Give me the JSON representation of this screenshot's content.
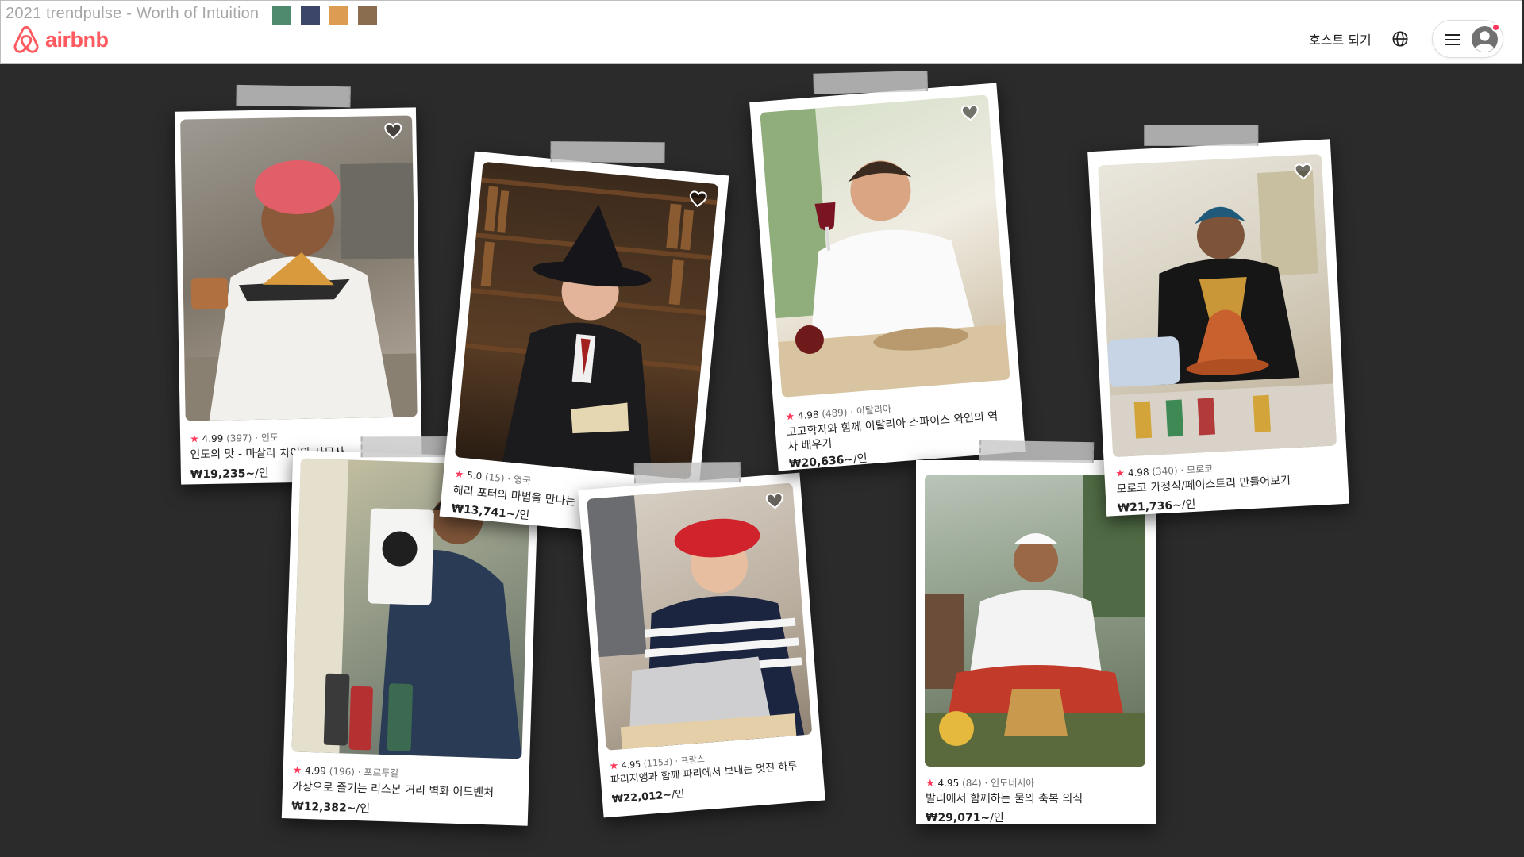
{
  "page_caption": "2021 trendpulse - Worth of Intuition",
  "palette": [
    "#4f8a6f",
    "#3c4668",
    "#dc9d52",
    "#8a6c4e"
  ],
  "brand": {
    "name": "airbnb",
    "color": "#FF5A5F"
  },
  "nav": {
    "host_link": "호스트 되기",
    "globe_icon": "globe-icon",
    "menu_icon": "menu-icon",
    "avatar_icon": "user-avatar-icon"
  },
  "experiences": [
    {
      "rating": "4.99",
      "reviews": "(397)",
      "location": "· 인도",
      "title": "인도의 맛 - 마살라 차이와 사모사",
      "price": "₩19,235~",
      "unit": "/인"
    },
    {
      "rating": "5.0",
      "reviews": "(15)",
      "location": "· 영국",
      "title": "해리 포터의 마법을 만나는 런던 온라인 투어",
      "price": "₩13,741~",
      "unit": "/인"
    },
    {
      "rating": "4.98",
      "reviews": "(489)",
      "location": "· 이탈리아",
      "title": "고고학자와 함께 이탈리아 스파이스 와인의 역사 배우기",
      "price": "₩20,636~",
      "unit": "/인"
    },
    {
      "rating": "4.98",
      "reviews": "(340)",
      "location": "· 모로코",
      "title": "모로코 가정식/페이스트리 만들어보기",
      "price": "₩21,736~",
      "unit": "/인"
    },
    {
      "rating": "4.99",
      "reviews": "(196)",
      "location": "· 포르투갈",
      "title": "가상으로 즐기는 리스본 거리 벽화 어드벤처",
      "price": "₩12,382~",
      "unit": "/인"
    },
    {
      "rating": "4.95",
      "reviews": "(1153)",
      "location": "· 프랑스",
      "title": "파리지앵과 함께 파리에서 보내는 멋진 하루",
      "price": "₩22,012~",
      "unit": "/인"
    },
    {
      "rating": "4.95",
      "reviews": "(84)",
      "location": "· 인도네시아",
      "title": "발리에서 함께하는 물의 축복 의식",
      "price": "₩29,071~",
      "unit": "/인"
    }
  ]
}
